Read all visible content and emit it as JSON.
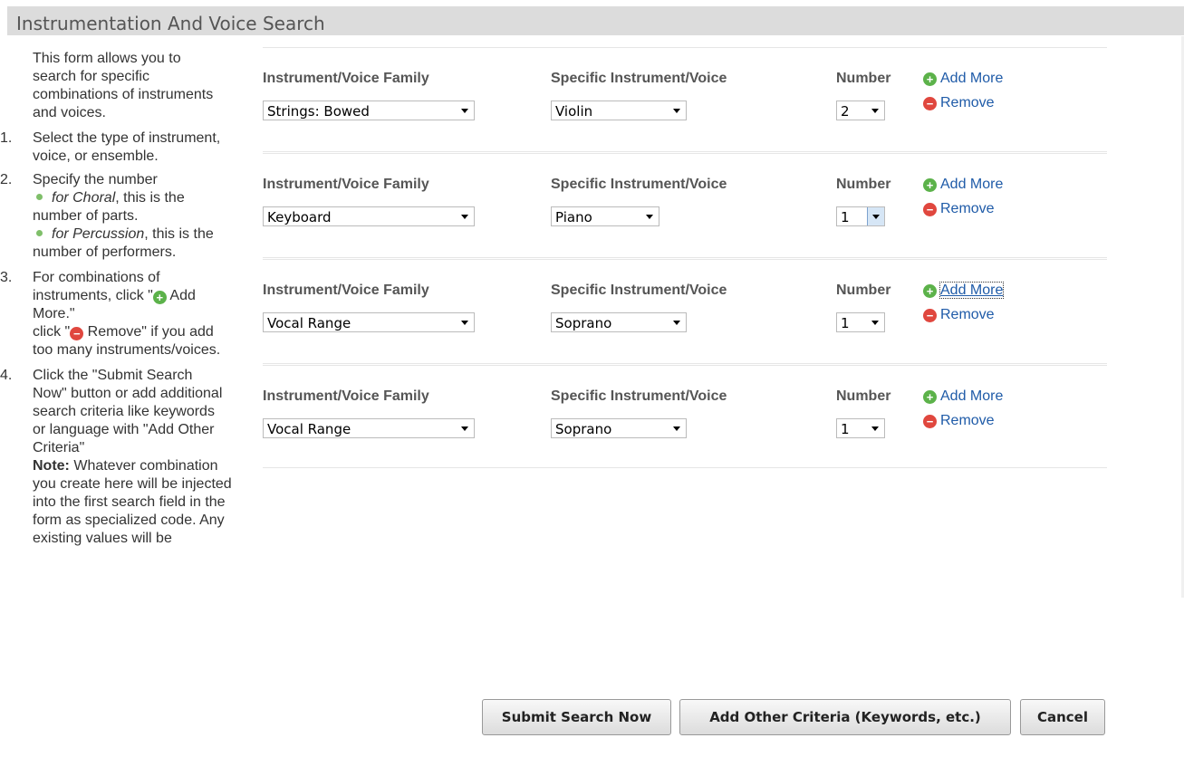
{
  "title": "Instrumentation And Voice Search",
  "instructions": {
    "intro": "This form allows you to search for specific combinations of instruments and voices.",
    "step1": "Select the type of instrument, voice, or ensemble.",
    "step2": "Specify the number",
    "step2_b1_em": "for Choral",
    "step2_b1_rest": ", this is the number of parts.",
    "step2_b2_em": "for Percussion",
    "step2_b2_rest": ", this is the number of performers.",
    "step3_a": "For combinations of instruments, click \"",
    "step3_b": " Add More.\"",
    "step3_c": "click \"",
    "step3_d": " Remove\" if you add too many instruments/voices.",
    "step4": "Click the \"Submit Search Now\" button or add additional search criteria like keywords or language with \"Add Other Criteria\"",
    "note_label": "Note:",
    "note_text": " Whatever combination you create here will be injected into the first search field in the form as specialized code. Any existing values will be",
    "num1": "1.",
    "num2": "2.",
    "num3": "3.",
    "num4": "4."
  },
  "labels": {
    "family": "Instrument/Voice Family",
    "specific": "Specific Instrument/Voice",
    "number": "Number",
    "add_more": "Add More",
    "remove": "Remove"
  },
  "rows": [
    {
      "family": "Strings: Bowed",
      "specific": "Violin",
      "number": "2"
    },
    {
      "family": "Keyboard",
      "specific": "Piano",
      "number": "1"
    },
    {
      "family": "Vocal Range",
      "specific": "Soprano",
      "number": "1"
    },
    {
      "family": "Vocal Range",
      "specific": "Soprano",
      "number": "1"
    }
  ],
  "buttons": {
    "submit": "Submit Search Now",
    "other": "Add Other Criteria (Keywords, etc.)",
    "cancel": "Cancel"
  },
  "colors": {
    "link": "#1f5ba8",
    "add_icon": "#5cb24a",
    "remove_icon": "#e0473e",
    "title_bar": "#dcdcdc"
  },
  "icons": {
    "add": "plus-circle-icon",
    "remove": "minus-circle-icon"
  }
}
